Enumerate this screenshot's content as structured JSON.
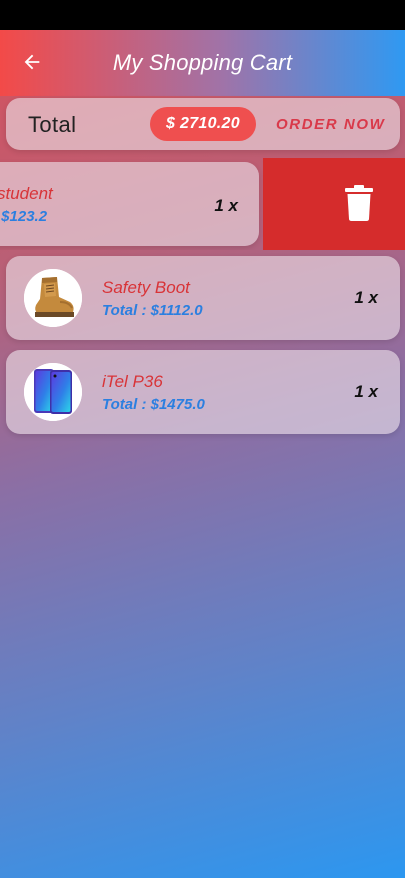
{
  "header": {
    "title": "My Shopping Cart",
    "back_icon": "arrow-left-icon"
  },
  "summary": {
    "total_label": "Total",
    "total_amount": "$ 2710.20",
    "order_button": "ORDER NOW"
  },
  "cart_items": [
    {
      "name": "student",
      "total": ": $123.2",
      "quantity": "1 x",
      "swiped": true
    },
    {
      "name": "Safety Boot",
      "total": "Total : $1112.0",
      "quantity": "1 x",
      "thumbnail": "boot-image"
    },
    {
      "name": "iTel P36",
      "total": "Total : $1475.0",
      "quantity": "1 x",
      "thumbnail": "phone-image"
    }
  ],
  "delete_action": {
    "icon": "trash-icon"
  },
  "colors": {
    "accent_red": "#ef4f4f",
    "name_red": "#d83438",
    "price_blue": "#2b7fe0",
    "delete_red": "#d52c2c"
  }
}
